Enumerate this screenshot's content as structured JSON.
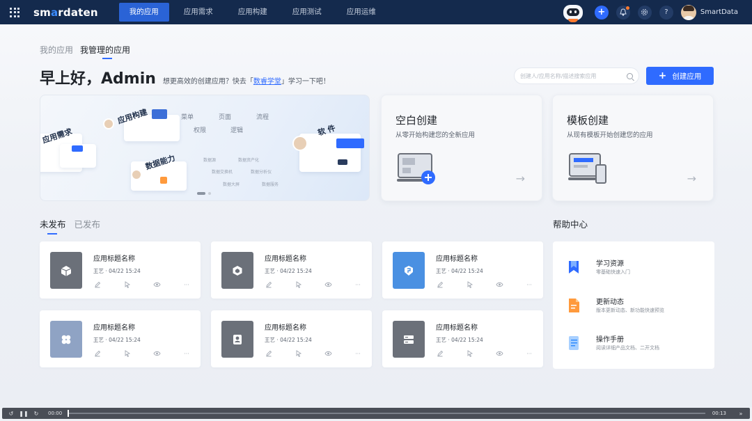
{
  "nav": {
    "logo": "smardaten",
    "items": [
      "我的应用",
      "应用需求",
      "应用构建",
      "应用测试",
      "应用运维"
    ],
    "active_index": 0,
    "username": "SmartData"
  },
  "page": {
    "tabs": [
      "我的应用",
      "我管理的应用"
    ],
    "active_tab": 1,
    "greeting": "早上好，Admin",
    "sub_prefix": "想更高效的创建应用？快去「",
    "sub_link": "数睿学堂",
    "sub_suffix": "」学习一下吧！",
    "search_placeholder": "创建人/应用名称/描述搜索应用",
    "create_button": "创建应用"
  },
  "banner": {
    "labels": [
      "应用需求",
      "应用构建",
      "数据能力",
      "菜单",
      "页面",
      "流程",
      "权限",
      "逻辑",
      "软  件"
    ],
    "small_labels": [
      "数据源",
      "数据资产化",
      "数据交换机",
      "数据分析仪",
      "数据大屏",
      "数据服务"
    ],
    "slides": 2,
    "active_slide": 0
  },
  "create_cards": [
    {
      "title": "空白创建",
      "subtitle": "从零开始构建您的全新应用",
      "arrow": "→"
    },
    {
      "title": "模板创建",
      "subtitle": "从现有模板开始创建您的应用",
      "arrow": "→"
    }
  ],
  "list": {
    "tabs": [
      "未发布",
      "已发布"
    ],
    "active_tab": 0,
    "apps": [
      {
        "name": "应用标题名称",
        "owner": "王艺",
        "date": "04/22 15:24",
        "icon": "cube-icon",
        "color": "#6b7079"
      },
      {
        "name": "应用标题名称",
        "owner": "王艺",
        "date": "04/22 15:24",
        "icon": "hexagon-icon",
        "color": "#6b7079"
      },
      {
        "name": "应用标题名称",
        "owner": "王艺",
        "date": "04/22 15:24",
        "icon": "shield-icon",
        "color": "#4a90e2"
      },
      {
        "name": "应用标题名称",
        "owner": "王艺",
        "date": "04/22 15:24",
        "icon": "clover-icon",
        "color": "#8fa3c4"
      },
      {
        "name": "应用标题名称",
        "owner": "王艺",
        "date": "04/22 15:24",
        "icon": "user-badge-icon",
        "color": "#6b7079"
      },
      {
        "name": "应用标题名称",
        "owner": "王艺",
        "date": "04/22 15:24",
        "icon": "server-icon",
        "color": "#6b7079"
      }
    ]
  },
  "help": {
    "title": "帮助中心",
    "items": [
      {
        "title": "学习资源",
        "desc": "零基础快速入门",
        "icon": "bookmark-icon",
        "color": "#2f6bff"
      },
      {
        "title": "更新动态",
        "desc": "版本更新动态、新功能快速预览",
        "icon": "document-icon",
        "color": "#ff9a3c"
      },
      {
        "title": "操作手册",
        "desc": "阅读详细产品文档、二开文档",
        "icon": "manual-icon",
        "color": "#4aa3ff"
      }
    ]
  },
  "video": {
    "time_current": "00:00",
    "time_total": "00:13",
    "progress": 0
  }
}
